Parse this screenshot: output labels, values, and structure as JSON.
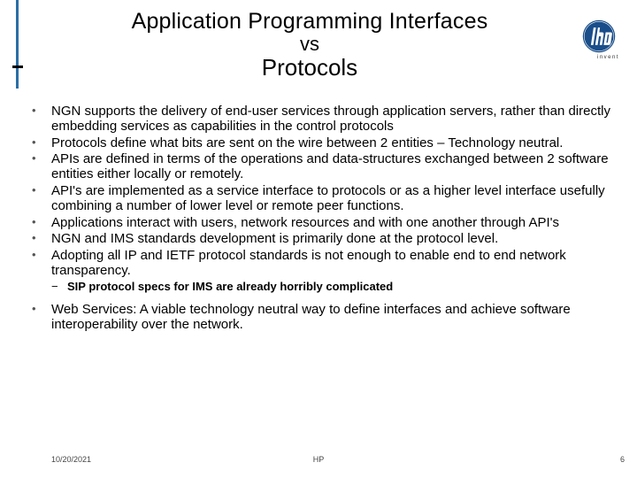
{
  "title": {
    "line1": "Application Programming Interfaces",
    "line2": "vs",
    "line3": "Protocols"
  },
  "logo": {
    "caption": "invent"
  },
  "bullets": [
    "NGN supports the delivery of end-user services through application servers, rather than directly embedding services as capabilities in the control protocols",
    "Protocols define what bits are sent on the wire between 2 entities – Technology neutral.",
    "APIs are defined in terms of the operations and data-structures exchanged between 2 software entities either locally or remotely.",
    "API's are implemented as a service interface to protocols or as a higher level interface usefully combining a number of lower level or remote peer functions.",
    "Applications interact with users, network resources and with one another through API's",
    "NGN and IMS standards development is primarily done at the protocol level.",
    "Adopting all IP and IETF protocol standards is not enough to enable end to end network transparency."
  ],
  "sub_bullets": [
    "SIP protocol specs for IMS are already horribly complicated"
  ],
  "last_bullet": "Web Services:  A viable technology neutral way to define interfaces and achieve software interoperability over the network.",
  "footer": {
    "date": "10/20/2021",
    "center": "HP",
    "page": "6"
  }
}
